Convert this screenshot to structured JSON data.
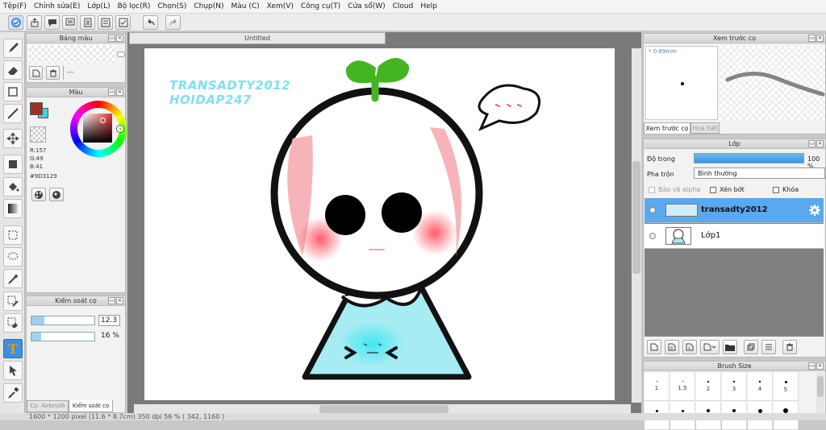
{
  "menu": [
    "Tệp(F)",
    "Chỉnh sửa(E)",
    "Lớp(L)",
    "Bộ lọc(R)",
    "Chọn(S)",
    "Chụp(N)",
    "Màu (C)",
    "Xem(V)",
    "Công cụ(T)",
    "Cửa sổ(W)",
    "Cloud",
    "Help"
  ],
  "panels": {
    "color_palette": {
      "title": "Bảng màu",
      "value": "---"
    },
    "color": {
      "title": "Màu",
      "r": "R:157",
      "g": "G:49",
      "b": "B:41",
      "hex": "#9D3129"
    },
    "brush_control": {
      "title": "Kiểm soát cọ",
      "size": "12.3",
      "opacity": "16 %",
      "tab_airbrush": "Cọ: Airbrush",
      "tab_control": "Kiểm soát cọ"
    },
    "preview": {
      "title": "Xem trước cọ",
      "size": "* 0.89mm",
      "tab_preview": "Xem trước cọ",
      "tab_pattern": "Hoa tiết"
    },
    "layers": {
      "title": "Lớp",
      "opacity_label": "Độ trong",
      "opacity_value": "100 %",
      "blend_label": "Pha trộn",
      "blend_value": "Bình thường",
      "protect_alpha": "Bảo vệ alpha",
      "clipping": "Xén bớt",
      "lock": "Khóa",
      "items": [
        {
          "name": "transadty2012",
          "selected": true
        },
        {
          "name": "Lớp1",
          "selected": false
        }
      ]
    },
    "brush_size": {
      "title": "Brush Size",
      "sizes": [
        "1",
        "1.5",
        "2",
        "3",
        "4",
        "5"
      ]
    }
  },
  "document": {
    "tab_title": "Untitled"
  },
  "artwork": {
    "watermark_line1": "TRANSADTY2012",
    "watermark_line2": "HOIDAP247"
  },
  "status": {
    "text": "1600 * 1200 pixel   (11.6 * 8.7cm)   350 dpi   56 %   ( 342, 1160 )"
  },
  "colors": {
    "accent": "#5aa8ee",
    "primary": "#9D3129",
    "secondary": "#48cfe0",
    "sprout": "#43b520",
    "shirt": "#a6ecf2"
  }
}
